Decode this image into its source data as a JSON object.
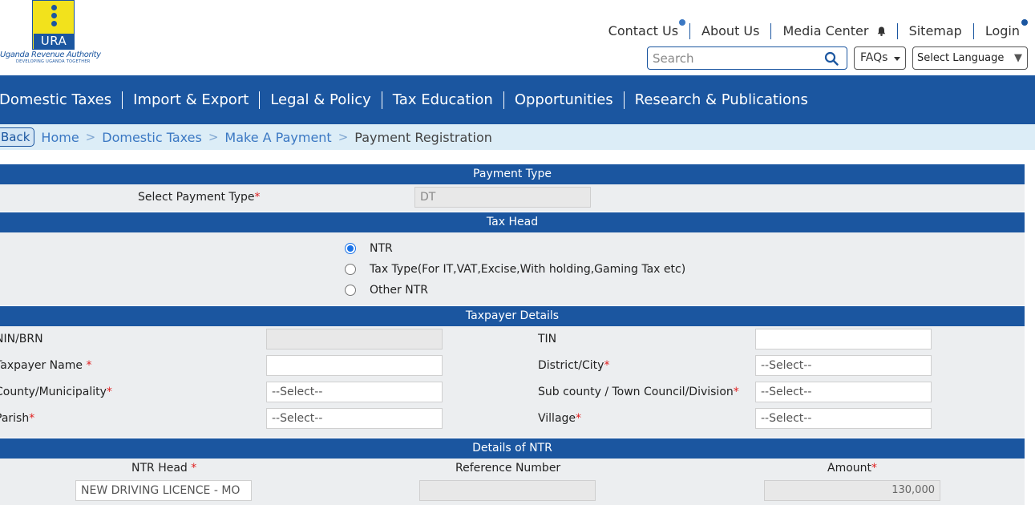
{
  "logo": {
    "short": "URA",
    "org": "Uganda Revenue Authority",
    "tagline": "DEVELOPING UGANDA TOGETHER"
  },
  "topnav": {
    "contact": "Contact Us",
    "about": "About Us",
    "media": "Media Center",
    "sitemap": "Sitemap",
    "login": "Login"
  },
  "search": {
    "placeholder": "Search"
  },
  "faqs": "FAQs",
  "language": "Select Language",
  "mainnav": [
    "Domestic Taxes",
    "Import & Export",
    "Legal & Policy",
    "Tax Education",
    "Opportunities",
    "Research & Publications"
  ],
  "breadcrumb": {
    "back": "Back",
    "items": [
      "Home",
      "Domestic Taxes",
      "Make A Payment"
    ],
    "current": "Payment Registration"
  },
  "payment_type": {
    "title": "Payment Type",
    "label": "Select Payment Type",
    "value": "DT"
  },
  "tax_head": {
    "title": "Tax Head",
    "options": [
      "NTR",
      "Tax Type(For IT,VAT,Excise,With holding,Gaming Tax etc)",
      "Other NTR"
    ],
    "selected": 0
  },
  "taxpayer": {
    "title": "Taxpayer Details",
    "nin": "NIN/BRN",
    "tin": "TIN",
    "name": "Taxpayer Name",
    "district": "District/City",
    "county": "County/Municipality",
    "subcounty": "Sub county / Town Council/Division",
    "parish": "Parish",
    "village": "Village",
    "select": "--Select--"
  },
  "ntr": {
    "title": "Details of NTR",
    "head_label": "NTR Head",
    "ref_label": "Reference Number",
    "amount_label": "Amount",
    "head_value": "NEW DRIVING LICENCE - MO",
    "amount_value": "130,000"
  },
  "colors": {
    "brand": "#1b56a0",
    "crumb_bg": "#dcedf7",
    "band_bg": "#eceef0"
  }
}
